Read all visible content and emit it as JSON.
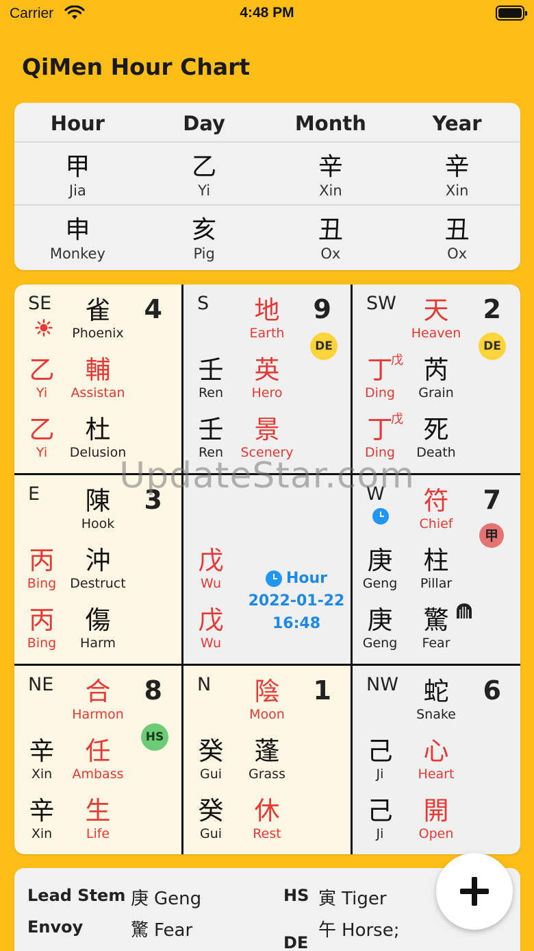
{
  "status_bar": {
    "carrier": "Carrier",
    "time": "4:48 PM"
  },
  "app_title": "QiMen Hour Chart",
  "pillars": {
    "headers": [
      "Hour",
      "Day",
      "Month",
      "Year"
    ],
    "stems": [
      {
        "cn": "甲",
        "py": "Jia"
      },
      {
        "cn": "乙",
        "py": "Yi"
      },
      {
        "cn": "辛",
        "py": "Xin"
      },
      {
        "cn": "辛",
        "py": "Xin"
      }
    ],
    "branches": [
      {
        "cn": "申",
        "py": "Monkey"
      },
      {
        "cn": "亥",
        "py": "Pig"
      },
      {
        "cn": "丑",
        "py": "Ox"
      },
      {
        "cn": "丑",
        "py": "Ox"
      }
    ]
  },
  "palaces": {
    "se": {
      "dir": "SE",
      "num": "4",
      "top": {
        "cn": "雀",
        "py": "Phoenix"
      },
      "mid_l": {
        "cn": "乙",
        "py": "Yi"
      },
      "mid_r": {
        "cn": "輔",
        "py": "Assistan"
      },
      "bot_l": {
        "cn": "乙",
        "py": "Yi"
      },
      "bot_r": {
        "cn": "杜",
        "py": "Delusion"
      }
    },
    "s": {
      "dir": "S",
      "num": "9",
      "badge": "DE",
      "top": {
        "cn": "地",
        "py": "Earth"
      },
      "mid_l": {
        "cn": "壬",
        "py": "Ren"
      },
      "mid_r": {
        "cn": "英",
        "py": "Hero"
      },
      "bot_l": {
        "cn": "壬",
        "py": "Ren"
      },
      "bot_r": {
        "cn": "景",
        "py": "Scenery"
      }
    },
    "sw": {
      "dir": "SW",
      "num": "2",
      "badge": "DE",
      "top": {
        "cn": "天",
        "py": "Heaven"
      },
      "mid_l": {
        "cn": "丁",
        "py": "Ding",
        "sup": "戊"
      },
      "mid_r": {
        "cn": "芮",
        "py": "Grain"
      },
      "bot_l": {
        "cn": "丁",
        "py": "Ding",
        "sup": "戊"
      },
      "bot_r": {
        "cn": "死",
        "py": "Death"
      }
    },
    "e": {
      "dir": "E",
      "num": "3",
      "top": {
        "cn": "陳",
        "py": "Hook"
      },
      "mid_l": {
        "cn": "丙",
        "py": "Bing"
      },
      "mid_r": {
        "cn": "沖",
        "py": "Destruct"
      },
      "bot_l": {
        "cn": "丙",
        "py": "Bing"
      },
      "bot_r": {
        "cn": "傷",
        "py": "Harm"
      }
    },
    "center": {
      "mid_l": {
        "cn": "戊",
        "py": "Wu"
      },
      "bot_l": {
        "cn": "戊",
        "py": "Wu"
      },
      "hour_label": "Hour",
      "date": "2022-01-22",
      "time": "16:48"
    },
    "w": {
      "dir": "W",
      "num": "7",
      "badge": "甲",
      "top": {
        "cn": "符",
        "py": "Chief"
      },
      "mid_l": {
        "cn": "庚",
        "py": "Geng"
      },
      "mid_r": {
        "cn": "柱",
        "py": "Pillar"
      },
      "bot_l": {
        "cn": "庚",
        "py": "Geng"
      },
      "bot_r": {
        "cn": "驚",
        "py": "Fear"
      }
    },
    "ne": {
      "dir": "NE",
      "num": "8",
      "badge": "HS",
      "top": {
        "cn": "合",
        "py": "Harmon"
      },
      "mid_l": {
        "cn": "辛",
        "py": "Xin"
      },
      "mid_r": {
        "cn": "任",
        "py": "Ambass"
      },
      "bot_l": {
        "cn": "辛",
        "py": "Xin"
      },
      "bot_r": {
        "cn": "生",
        "py": "Life"
      }
    },
    "n": {
      "dir": "N",
      "num": "1",
      "top": {
        "cn": "陰",
        "py": "Moon"
      },
      "mid_l": {
        "cn": "癸",
        "py": "Gui"
      },
      "mid_r": {
        "cn": "蓬",
        "py": "Grass"
      },
      "bot_l": {
        "cn": "癸",
        "py": "Gui"
      },
      "bot_r": {
        "cn": "休",
        "py": "Rest"
      }
    },
    "nw": {
      "dir": "NW",
      "num": "6",
      "top": {
        "cn": "蛇",
        "py": "Snake"
      },
      "mid_l": {
        "cn": "己",
        "py": "Ji"
      },
      "mid_r": {
        "cn": "心",
        "py": "Heart"
      },
      "bot_l": {
        "cn": "己",
        "py": "Ji"
      },
      "bot_r": {
        "cn": "開",
        "py": "Open"
      }
    }
  },
  "watermark": "UpdateStar.com",
  "info": {
    "lead_stem_label": "Lead Stem",
    "lead_stem_cn": "庚",
    "lead_stem_py": "Geng",
    "envoy_label": "Envoy",
    "envoy_cn": "驚",
    "envoy_py": "Fear",
    "hs_label": "HS",
    "hs_cn": "寅",
    "hs_py": "Tiger",
    "de_label": "DE",
    "de_cn": "午",
    "de_py": "Horse;"
  },
  "colors": {
    "background": "#FFBE17",
    "red_text": "#E53935",
    "blue_text": "#1E88E5"
  }
}
